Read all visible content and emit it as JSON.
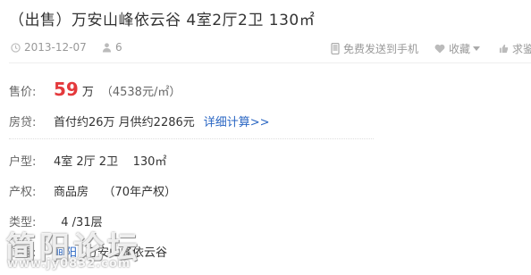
{
  "listing": {
    "title": "（出售）万安山峰依云谷  4室2厅2卫  130㎡"
  },
  "meta": {
    "date": "2013-12-07",
    "views": "6",
    "send_to_phone": "免费发送到手机",
    "favorite": "收藏",
    "more": "求鉴"
  },
  "details": {
    "price": {
      "label": "售价:",
      "value": "59",
      "unit": "万",
      "unit_price": "（4538元/㎡）"
    },
    "loan": {
      "label": "房贷:",
      "text": "首付约26万  月供约2286元",
      "link": "详细计算>>"
    },
    "layout": {
      "label": "户型:",
      "value": "4室 2厅 2卫    130㎡"
    },
    "ownership": {
      "label": "产权:",
      "value": "商品房    （70年产权）"
    },
    "type": {
      "label": "类型:",
      "value": "  4 /31层"
    },
    "location": {
      "label": "位置:",
      "district": "涧阳",
      "community": "万安山峰依云谷"
    }
  },
  "watermark": {
    "big": "简阳论坛",
    "small": "www.jy0832.com"
  },
  "colors": {
    "accent_price": "#e4393c",
    "link": "#2a66c3"
  }
}
